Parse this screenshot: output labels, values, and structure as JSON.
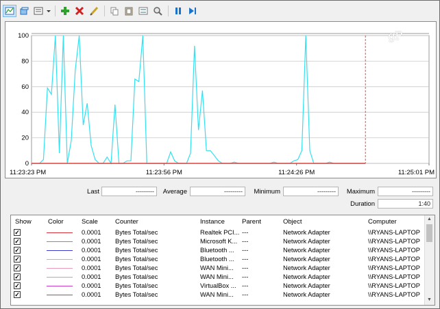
{
  "toolbar": {
    "icons": [
      "view-graph-icon",
      "chart-type-icon",
      "view-report-icon",
      "dropdown-arrow-icon",
      "add-counter-icon",
      "delete-counter-icon",
      "highlight-icon",
      "copy-properties-icon",
      "paste-counter-list-icon",
      "properties-icon",
      "zoom-icon",
      "freeze-display-icon",
      "update-data-icon"
    ],
    "colors": {
      "add": "#2ea12e",
      "delete": "#d21f1f",
      "highlight": "#c9a227",
      "pause": "#1c71c9"
    }
  },
  "watermark": "gP",
  "chart_data": {
    "type": "line",
    "ylim": [
      0,
      100
    ],
    "yticks": [
      "100",
      "80",
      "60",
      "40",
      "20",
      "0"
    ],
    "xticks": [
      "11:23:23 PM",
      "11:23:56 PM",
      "11:24:26 PM",
      "11:25:01 PM"
    ],
    "grid": true,
    "duration_seconds": 100,
    "current_marker_x": 84,
    "series": [
      {
        "color": "#33e0f0",
        "x": [
          0,
          1,
          2,
          3,
          4,
          5,
          6,
          7,
          8,
          9,
          10,
          11,
          12,
          13,
          14,
          15,
          16,
          17,
          18,
          19,
          20,
          21,
          22,
          23,
          24,
          25,
          26,
          27,
          28,
          29,
          30,
          31,
          32,
          33,
          34,
          35,
          36,
          37,
          38,
          39,
          40,
          41,
          42,
          43,
          44,
          45,
          46,
          47,
          48,
          49,
          50,
          51,
          52,
          53,
          54,
          55,
          56,
          57,
          58,
          59,
          60,
          61,
          62,
          63,
          64,
          65,
          66,
          67,
          68,
          69,
          70,
          71,
          72,
          73,
          74,
          75,
          76,
          77,
          78,
          79,
          80,
          81,
          82,
          83,
          84
        ],
        "y": [
          0,
          0,
          0,
          3,
          59,
          54,
          100,
          8,
          100,
          0,
          18,
          73,
          100,
          30,
          47,
          14,
          3,
          0,
          0,
          5,
          0,
          46,
          0,
          0,
          2,
          2,
          66,
          64,
          100,
          0,
          0,
          0,
          0,
          0,
          0,
          9,
          2,
          0,
          0,
          0,
          8,
          92,
          26,
          57,
          10,
          10,
          6,
          2,
          0,
          0,
          0,
          1,
          0,
          0,
          0,
          0,
          0,
          0,
          0,
          0,
          0,
          1,
          0,
          0,
          0,
          0,
          2,
          3,
          10,
          100,
          10,
          0,
          0,
          0,
          0,
          1,
          0,
          0,
          0,
          0,
          0,
          0,
          0,
          0,
          0
        ]
      },
      {
        "color": "#e0403a",
        "x": [
          0,
          84
        ],
        "y": [
          0,
          0
        ]
      }
    ]
  },
  "stats": {
    "last_label": "Last",
    "last_value": "---------",
    "average_label": "Average",
    "average_value": "---------",
    "minimum_label": "Minimum",
    "minimum_value": "---------",
    "maximum_label": "Maximum",
    "maximum_value": "---------",
    "duration_label": "Duration",
    "duration_value": "1:40"
  },
  "table": {
    "headers": {
      "show": "Show",
      "color": "Color",
      "scale": "Scale",
      "counter": "Counter",
      "instance": "Instance",
      "parent": "Parent",
      "object": "Object",
      "computer": "Computer"
    },
    "rows": [
      {
        "color": "#d8303a",
        "scale": "0.0001",
        "counter": "Bytes Total/sec",
        "instance": "Realtek PCI...",
        "parent": "---",
        "object": "Network Adapter",
        "computer": "\\\\RYANS-LAPTOP"
      },
      {
        "color": "#3fbf3f",
        "scale": "0.0001",
        "counter": "Bytes Total/sec",
        "instance": "Microsoft K...",
        "parent": "---",
        "object": "Network Adapter",
        "computer": "\\\\RYANS-LAPTOP"
      },
      {
        "color": "#3a3ad0",
        "scale": "0.0001",
        "counter": "Bytes Total/sec",
        "instance": "Bluetooth ...",
        "parent": "---",
        "object": "Network Adapter",
        "computer": "\\\\RYANS-LAPTOP"
      },
      {
        "color": "#c8c040",
        "scale": "0.0001",
        "counter": "Bytes Total/sec",
        "instance": "Bluetooth ...",
        "parent": "---",
        "object": "Network Adapter",
        "computer": "\\\\RYANS-LAPTOP"
      },
      {
        "color": "#e89ab8",
        "scale": "0.0001",
        "counter": "Bytes Total/sec",
        "instance": "WAN Mini...",
        "parent": "---",
        "object": "Network Adapter",
        "computer": "\\\\RYANS-LAPTOP"
      },
      {
        "color": "#33e0f0",
        "scale": "0.0001",
        "counter": "Bytes Total/sec",
        "instance": "WAN Mini...",
        "parent": "---",
        "object": "Network Adapter",
        "computer": "\\\\RYANS-LAPTOP"
      },
      {
        "color": "#c83cc8",
        "scale": "0.0001",
        "counter": "Bytes Total/sec",
        "instance": "VirtualBox ...",
        "parent": "---",
        "object": "Network Adapter",
        "computer": "\\\\RYANS-LAPTOP"
      },
      {
        "color": "#a040a8",
        "scale": "0.0001",
        "counter": "Bytes Total/sec",
        "instance": "WAN Mini...",
        "parent": "---",
        "object": "Network Adapter",
        "computer": "\\\\RYANS-LAPTOP"
      }
    ]
  }
}
